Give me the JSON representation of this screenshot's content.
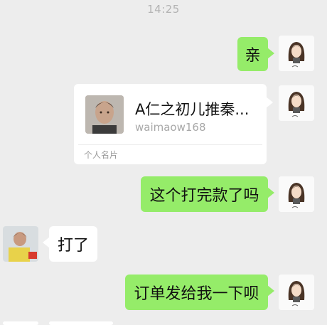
{
  "time": "14:25",
  "messages": {
    "m1": "亲",
    "m3": "这个打完款了吗",
    "m4": "打了",
    "m5": "订单发给我一下呗"
  },
  "card": {
    "name": "A仁之初儿推秦...",
    "id": "waimaow168",
    "label": "个人名片"
  },
  "colors": {
    "background": "#ededed",
    "outgoing_bubble": "#95ec69",
    "incoming_bubble": "#ffffff"
  },
  "icons": {
    "self_avatar": "cartoon-girl-avatar",
    "contact_avatar": "person-photo-avatar",
    "card_photo": "man-portrait-photo"
  }
}
